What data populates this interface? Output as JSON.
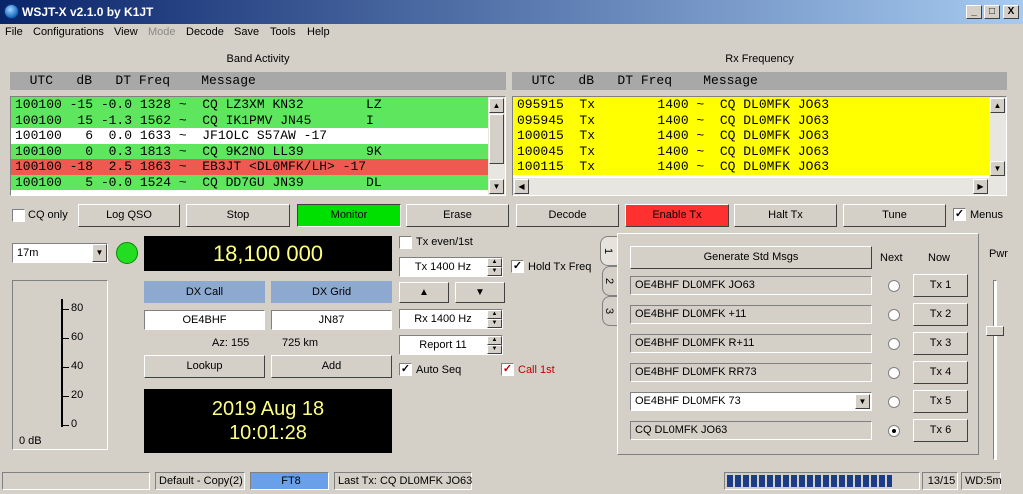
{
  "window": {
    "title": "WSJT-X   v2.1.0   by K1JT",
    "controls": {
      "minimize": "_",
      "maximize": "□",
      "close": "X"
    }
  },
  "menu": [
    "File",
    "Configurations",
    "View",
    "Mode",
    "Decode",
    "Save",
    "Tools",
    "Help"
  ],
  "band_activity": {
    "title": "Band Activity",
    "header": "  UTC   dB   DT Freq    Message",
    "rows": [
      {
        "text": "100100 -15 -0.0 1328 ~  CQ LZ3XM KN32        LZ",
        "color": "#5ee65e"
      },
      {
        "text": "100100  15 -1.3 1562 ~  CQ IK1PMV JN45       I",
        "color": "#5ee65e"
      },
      {
        "text": "100100   6  0.0 1633 ~  JF1OLC S57AW -17",
        "color": "#ffffff"
      },
      {
        "text": "100100   0  0.3 1813 ~  CQ 9K2NO LL39        9K",
        "color": "#5ee65e"
      },
      {
        "text": "100100 -18  2.5 1863 ~  EB3JT <DL0MFK/LH> -17",
        "color": "#ee5a4f"
      },
      {
        "text": "100100   5 -0.0 1524 ~  CQ DD7GU JN39        DL",
        "color": "#5ee65e"
      }
    ]
  },
  "rx_frequency": {
    "title": "Rx Frequency",
    "header": "  UTC   dB   DT Freq    Message",
    "rows": [
      {
        "text": "095915  Tx        1400 ~  CQ DL0MFK JO63",
        "color": "#ffff00"
      },
      {
        "text": "095945  Tx        1400 ~  CQ DL0MFK JO63",
        "color": "#ffff00"
      },
      {
        "text": "100015  Tx        1400 ~  CQ DL0MFK JO63",
        "color": "#ffff00"
      },
      {
        "text": "100045  Tx        1400 ~  CQ DL0MFK JO63",
        "color": "#ffff00"
      },
      {
        "text": "100115  Tx        1400 ~  CQ DL0MFK JO63",
        "color": "#ffff00"
      }
    ]
  },
  "controls": {
    "cq_only": "CQ only",
    "log_qso": "Log QSO",
    "stop": "Stop",
    "monitor": "Monitor",
    "erase": "Erase",
    "decode": "Decode",
    "enable_tx": "Enable Tx",
    "halt_tx": "Halt Tx",
    "tune": "Tune",
    "menus": "Menus"
  },
  "left_panel": {
    "band": "17m",
    "frequency": "18,100 000",
    "dx_call_label": "DX Call",
    "dx_grid_label": "DX Grid",
    "dx_call": "OE4BHF",
    "dx_grid": "JN87",
    "az": "Az: 155",
    "distance": "725 km",
    "lookup": "Lookup",
    "add": "Add",
    "date": "2019 Aug 18",
    "time": "10:01:28",
    "meter_ticks": [
      "80",
      "60",
      "40",
      "20",
      "0"
    ],
    "meter_readout": "0 dB"
  },
  "mid_panel": {
    "tx_even": "Tx even/1st",
    "tx_freq": "Tx  1400  Hz",
    "hold_tx_freq": "Hold Tx Freq",
    "up": "▲",
    "down": "▼",
    "rx_freq": "Rx  1400  Hz",
    "report": "Report 11",
    "auto_seq": "Auto Seq",
    "call_1st": "Call 1st"
  },
  "tabs": [
    "1",
    "2",
    "3"
  ],
  "tx_panel": {
    "generate": "Generate Std Msgs",
    "next": "Next",
    "now": "Now",
    "messages": [
      {
        "text": "OE4BHF DL0MFK JO63",
        "tx": "Tx 1",
        "selected": false
      },
      {
        "text": "OE4BHF DL0MFK +11",
        "tx": "Tx 2",
        "selected": false
      },
      {
        "text": "OE4BHF DL0MFK R+11",
        "tx": "Tx 3",
        "selected": false
      },
      {
        "text": "OE4BHF DL0MFK RR73",
        "tx": "Tx 4",
        "selected": false
      },
      {
        "text": "OE4BHF DL0MFK 73",
        "tx": "Tx 5",
        "selected": false
      },
      {
        "text": "CQ DL0MFK JO63",
        "tx": "Tx 6",
        "selected": true
      }
    ],
    "pwr": "Pwr"
  },
  "status": {
    "config": "Default - Copy(2)",
    "mode": "FT8",
    "last_tx": "Last Tx: CQ DL0MFK JO63",
    "progress": 0.87,
    "period": "13/15",
    "wd": "WD:5m"
  },
  "colors": {
    "monitor_on": "#00e000",
    "enable_tx": "#ff3030",
    "mode_cell": "#6aa0e8",
    "progress": "#1a3c8c"
  }
}
